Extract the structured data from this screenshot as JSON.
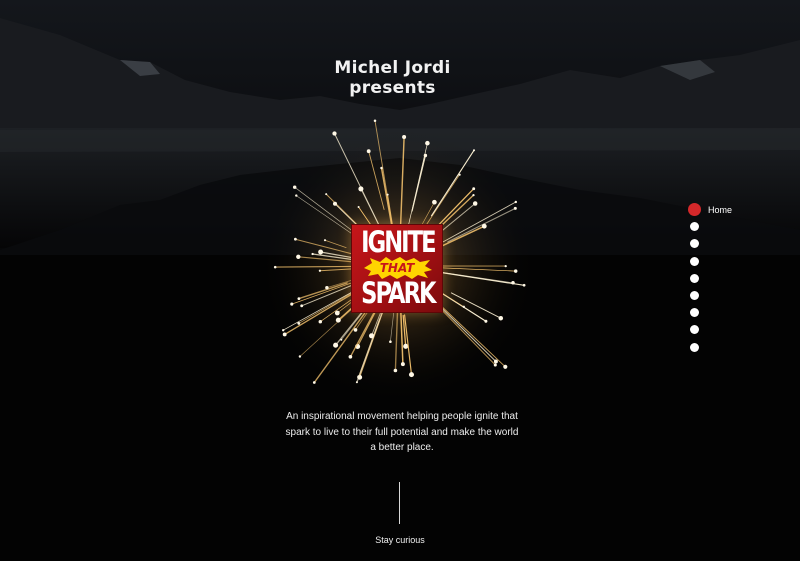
{
  "header": {
    "presenter_name": "Michel Jordi",
    "presenter_verb": "presents"
  },
  "logo": {
    "line1": "IGNITE",
    "line2": "THAT",
    "line3": "SPARK",
    "colors": {
      "box": "#c7161a",
      "burst": "#ffd400",
      "text": "#ffffff"
    }
  },
  "tagline": "An inspirational movement helping people ignite that spark to live to their full potential and make the world a better place.",
  "scroll_hint": "Stay curious",
  "nav": {
    "items": [
      {
        "label": "Home",
        "active": true
      },
      {
        "label": "",
        "active": false
      },
      {
        "label": "",
        "active": false
      },
      {
        "label": "",
        "active": false
      },
      {
        "label": "",
        "active": false
      },
      {
        "label": "",
        "active": false
      },
      {
        "label": "",
        "active": false
      },
      {
        "label": "",
        "active": false
      },
      {
        "label": "",
        "active": false
      }
    ],
    "active_color": "#d4282a",
    "dot_color": "#ffffff"
  }
}
